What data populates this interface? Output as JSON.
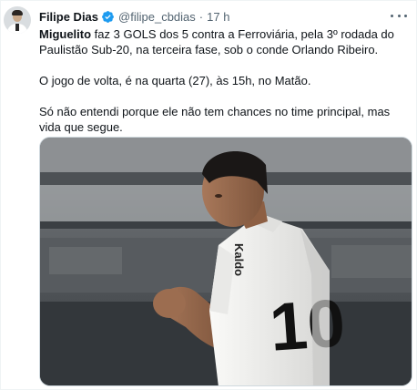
{
  "tweet": {
    "author": {
      "name": "Filipe Dias",
      "handle": "@filipe_cbdias",
      "separator": "·",
      "time": "17 h",
      "verified": true,
      "verified_color": "#1d9bf0"
    },
    "body": {
      "line1_bold": "Miguelito",
      "line1_rest": " faz 3 GOLS dos 5 contra a Ferroviária, pela 3º rodada do Paulistão Sub-20, na terceira fase, sob o conde Orlando Ribeiro.",
      "paragraph2": "O jogo de volta, é na quarta (27), às 15h, no Matão.",
      "paragraph3": "Só não entendi porque ele não tem chances no time principal, mas vida que segue."
    },
    "media": {
      "description_icon": "photo-icon",
      "jersey_sponsor": "Kaldo",
      "jersey_number": "10",
      "colors": {
        "jersey": "#f4f4f2",
        "background_top": "#6f7275",
        "background_bottom": "#2e3236"
      }
    },
    "more_icon": "more-options-icon"
  }
}
